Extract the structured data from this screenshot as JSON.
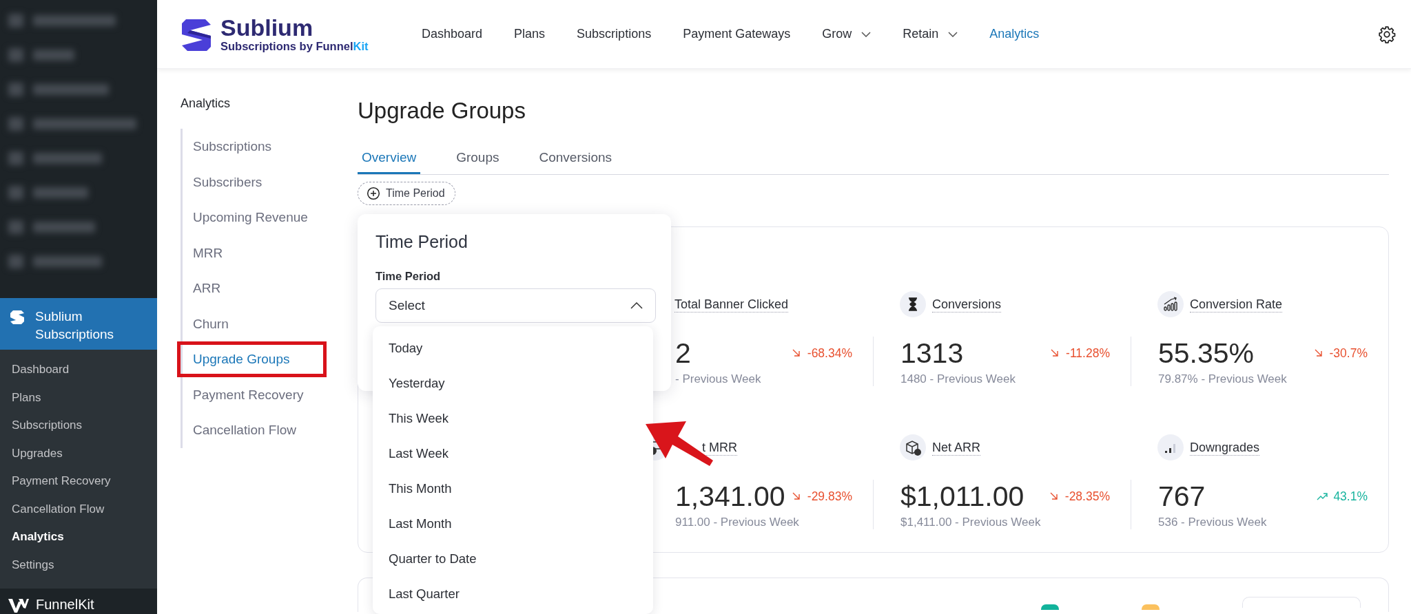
{
  "wp_menu": {
    "active_item": {
      "label": "Sublium Subscriptions",
      "selected": true
    },
    "items": [
      {
        "label": "Dashboard",
        "selected": false
      },
      {
        "label": "Plans",
        "selected": false
      },
      {
        "label": "Subscriptions",
        "selected": false
      },
      {
        "label": "Upgrades",
        "selected": false
      },
      {
        "label": "Payment Recovery",
        "selected": false
      },
      {
        "label": "Cancellation Flow",
        "selected": false
      },
      {
        "label": "Analytics",
        "selected": true
      },
      {
        "label": "Settings",
        "selected": false
      }
    ],
    "footer": {
      "label": "FunnelKit"
    }
  },
  "header": {
    "brand": {
      "title": "Sublium",
      "subtitle": "Subscriptions by Funnel",
      "subtitle_accent": "Kit"
    },
    "nav": [
      {
        "label": "Dashboard",
        "selected": false,
        "has_menu": false
      },
      {
        "label": "Plans",
        "selected": false,
        "has_menu": false
      },
      {
        "label": "Subscriptions",
        "selected": false,
        "has_menu": false
      },
      {
        "label": "Payment Gateways",
        "selected": false,
        "has_menu": false
      },
      {
        "label": "Grow",
        "selected": false,
        "has_menu": true
      },
      {
        "label": "Retain",
        "selected": false,
        "has_menu": true
      },
      {
        "label": "Analytics",
        "selected": true,
        "has_menu": false
      }
    ]
  },
  "subnav": {
    "title": "Analytics",
    "items": [
      {
        "label": "Subscriptions",
        "selected": false,
        "highlighted": false
      },
      {
        "label": "Subscribers",
        "selected": false,
        "highlighted": false
      },
      {
        "label": "Upcoming Revenue",
        "selected": false,
        "highlighted": false
      },
      {
        "label": "MRR",
        "selected": false,
        "highlighted": false
      },
      {
        "label": "ARR",
        "selected": false,
        "highlighted": false
      },
      {
        "label": "Churn",
        "selected": false,
        "highlighted": false
      },
      {
        "label": "Upgrade Groups",
        "selected": true,
        "highlighted": true
      },
      {
        "label": "Payment Recovery",
        "selected": false,
        "highlighted": false
      },
      {
        "label": "Cancellation Flow",
        "selected": false,
        "highlighted": false
      }
    ]
  },
  "page": {
    "title": "Upgrade Groups",
    "tabs": [
      {
        "label": "Overview",
        "selected": true
      },
      {
        "label": "Groups",
        "selected": false
      },
      {
        "label": "Conversions",
        "selected": false
      }
    ],
    "filter_chip": {
      "label": "Time Period"
    },
    "stats": [
      [
        {
          "label": "Total Banner Clicked",
          "value": "2",
          "change": "-68.34%",
          "rising": false,
          "previous": "- Previous Week"
        },
        {
          "label": "Conversions",
          "value": "1313",
          "change": "-11.28%",
          "rising": false,
          "previous": "1480 - Previous Week"
        },
        {
          "label": "Conversion Rate",
          "value": "55.35%",
          "change": "-30.7%",
          "rising": false,
          "previous": "79.87% - Previous Week"
        }
      ],
      [
        {
          "label": "t MRR",
          "value": "1,341.00",
          "change": "-29.83%",
          "rising": false,
          "previous": "911.00 - Previous Week"
        },
        {
          "label": "Net ARR",
          "value": "$1,011.00",
          "change": "-28.35%",
          "rising": false,
          "previous": "$1,411.00 - Previous Week"
        },
        {
          "label": "Downgrades",
          "value": "767",
          "change": "43.1%",
          "rising": true,
          "previous": "536 - Previous Week"
        }
      ]
    ],
    "legend": [
      {
        "color": "#12b39b"
      },
      {
        "color": "#fbc15e"
      }
    ],
    "popover": {
      "title": "Time Period",
      "field_label": "Time Period",
      "select_value": "Select",
      "expanded": true,
      "options": [
        "Today",
        "Yesterday",
        "This Week",
        "Last Week",
        "This Month",
        "Last Month",
        "Quarter to Date",
        "Last Quarter"
      ]
    }
  },
  "annotation": {
    "arrow": true
  }
}
